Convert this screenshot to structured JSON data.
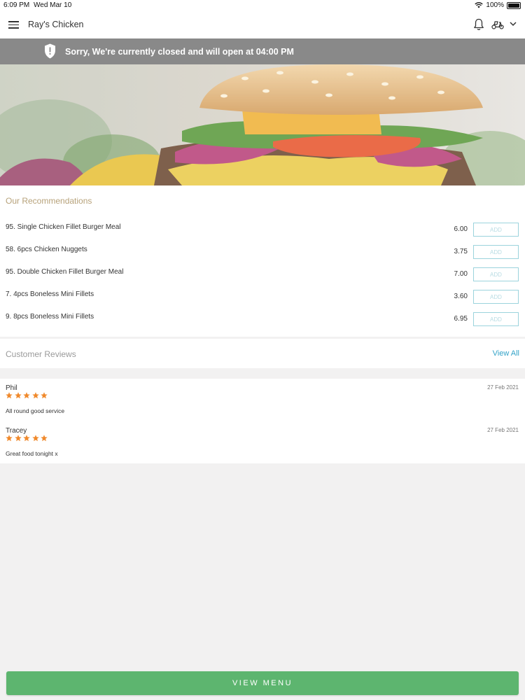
{
  "status_bar": {
    "time": "6:09 PM",
    "date": "Wed Mar 10",
    "battery": "100%"
  },
  "app_bar": {
    "title": "Ray's Chicken"
  },
  "banner": {
    "text": "Sorry, We're currently closed and will open at 04:00 PM"
  },
  "recommendations": {
    "title": "Our Recommendations",
    "add_label": "ADD",
    "items": [
      {
        "name": "95. Single Chicken Fillet Burger Meal",
        "price": "6.00"
      },
      {
        "name": "58. 6pcs Chicken Nuggets",
        "price": "3.75"
      },
      {
        "name": "95. Double Chicken Fillet Burger Meal",
        "price": "7.00"
      },
      {
        "name": "7. 4pcs Boneless Mini Fillets",
        "price": "3.60"
      },
      {
        "name": "9. 8pcs Boneless Mini Fillets",
        "price": "6.95"
      }
    ]
  },
  "reviews": {
    "title": "Customer Reviews",
    "view_all": "View All",
    "items": [
      {
        "author": "Phil",
        "date": "27 Feb 2021",
        "rating": 5,
        "text": "All round good service"
      },
      {
        "author": "Tracey",
        "date": "27 Feb 2021",
        "rating": 5,
        "text": "Great food tonight x"
      }
    ]
  },
  "footer": {
    "button": "VIEW MENU"
  },
  "colors": {
    "accent_green": "#5db56f",
    "banner_gray": "#898989",
    "star_orange": "#f0892b",
    "link_blue": "#33a3c8",
    "section_gold": "#b7a27a"
  }
}
